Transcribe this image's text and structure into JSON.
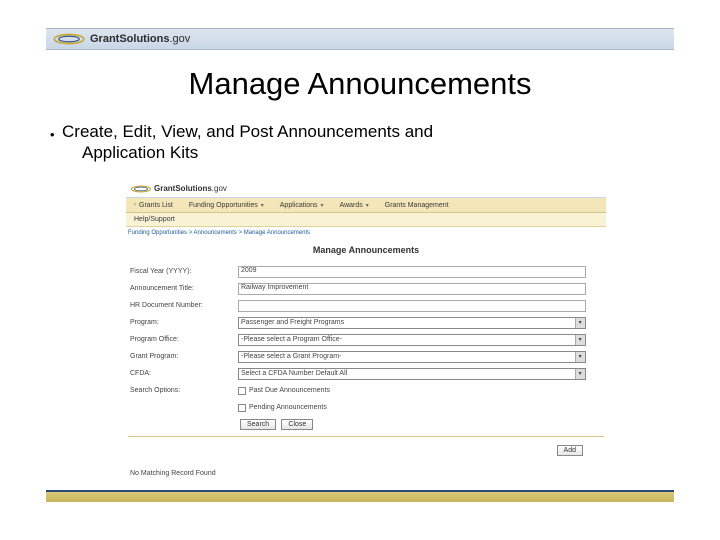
{
  "header": {
    "brand_bold1": "Grant",
    "brand_bold2": "Solutions",
    "brand_tld": ".gov"
  },
  "slide": {
    "title": "Manage Announcements",
    "bullet_line1": "Create, Edit, View, and Post Announcements and",
    "bullet_line2": "Application Kits"
  },
  "app": {
    "brand_bold1": "Grant",
    "brand_bold2": "Solutions",
    "brand_tld": ".gov",
    "nav": {
      "item0": "Grants List",
      "item1": "Funding Opportunities",
      "item2": "Applications",
      "item3": "Awards",
      "item4": "Grants Management",
      "sub0": "Help/Support"
    },
    "crumb": "Funding Opportunities > Announcements > Manage Announcements",
    "page_title": "Manage Announcements",
    "form": {
      "fy_label": "Fiscal Year (YYYY):",
      "fy_value": "2009",
      "title_label": "Announcement Title:",
      "title_value": "Railway Improvement",
      "docnum_label": "HR Document Number:",
      "docnum_value": "",
      "program_label": "Program:",
      "program_value": "Passenger and Freight Programs",
      "office_label": "Program Office:",
      "office_value": "-Please select a Program Office-",
      "grant_label": "Grant Program:",
      "grant_value": "-Please select a Grant Program-",
      "cfda_label": "CFDA:",
      "cfda_value": "Select a CFDA Number Default All",
      "opts_label": "Search Options:",
      "opt1": "Past Due Announcements",
      "opt2": "Pending Announcements",
      "search_btn": "Search",
      "close_btn": "Close",
      "add_btn": "Add"
    },
    "results": {
      "none": "No Matching Record Found"
    }
  }
}
